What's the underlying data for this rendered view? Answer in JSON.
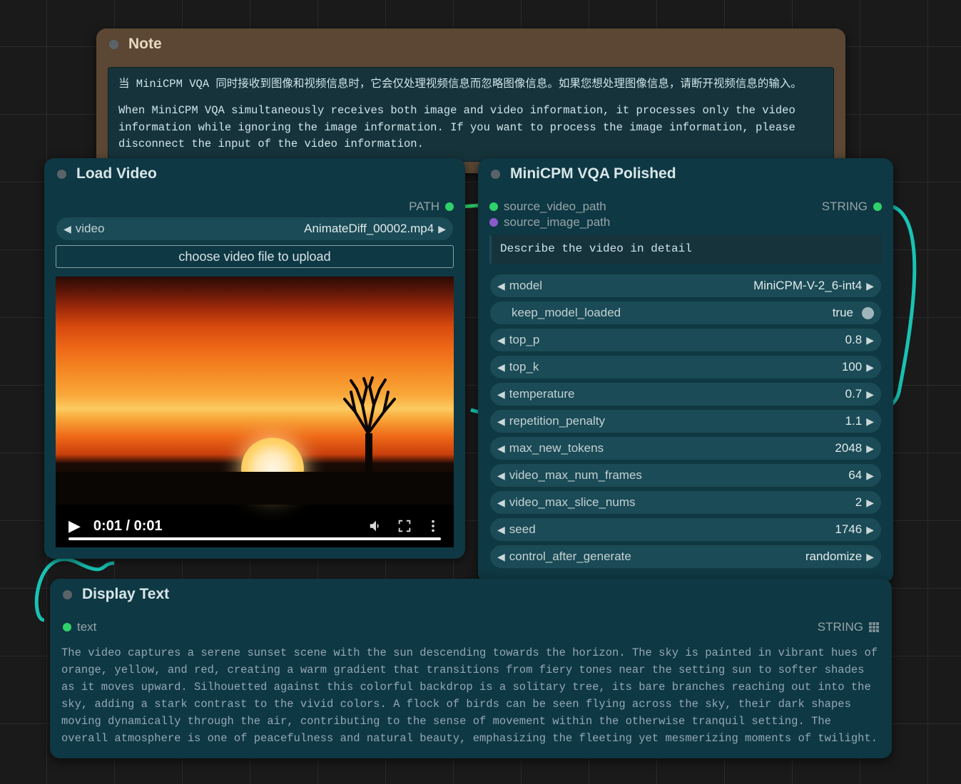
{
  "note": {
    "title": "Note",
    "text_cn": "当 MiniCPM VQA 同时接收到图像和视频信息时，它会仅处理视频信息而忽略图像信息。如果您想处理图像信息，请断开视频信息的输入。",
    "text_en": "When MiniCPM VQA simultaneously receives both image and video information, it processes only the video information while ignoring the image information. If you want to process the image information, please disconnect the input of the video information."
  },
  "load_video": {
    "title": "Load Video",
    "out_label": "PATH",
    "video_label": "video",
    "video_value": "AnimateDiff_00002.mp4",
    "choose_btn": "choose video file to upload",
    "player_time": "0:01 / 0:01"
  },
  "vqa": {
    "title": "MiniCPM VQA Polished",
    "out_label": "STRING",
    "in1": "source_video_path",
    "in2": "source_image_path",
    "prompt": "Describe the video in detail",
    "params": [
      {
        "label": "model",
        "value": "MiniCPM-V-2_6-int4",
        "arrows": true
      },
      {
        "label": "keep_model_loaded",
        "value": "true",
        "toggle": true
      },
      {
        "label": "top_p",
        "value": "0.8",
        "arrows": true
      },
      {
        "label": "top_k",
        "value": "100",
        "arrows": true
      },
      {
        "label": "temperature",
        "value": "0.7",
        "arrows": true
      },
      {
        "label": "repetition_penalty",
        "value": "1.1",
        "arrows": true
      },
      {
        "label": "max_new_tokens",
        "value": "2048",
        "arrows": true
      },
      {
        "label": "video_max_num_frames",
        "value": "64",
        "arrows": true
      },
      {
        "label": "video_max_slice_nums",
        "value": "2",
        "arrows": true
      },
      {
        "label": "seed",
        "value": "1746",
        "arrows": true
      },
      {
        "label": "control_after_generate",
        "value": "randomize",
        "arrows": true
      }
    ]
  },
  "display": {
    "title": "Display Text",
    "in_label": "text",
    "out_label": "STRING",
    "body": "The video captures a serene sunset scene with the sun descending towards the horizon. The sky is painted in vibrant hues of orange, yellow, and red, creating a warm gradient that transitions from fiery tones near the setting sun to softer shades as it moves upward. Silhouetted against this colorful backdrop is a solitary tree, its bare branches reaching out into the sky, adding a stark contrast to the vivid colors. A flock of birds can be seen flying across the sky, their dark shapes moving dynamically through the air, contributing to the sense of movement within the otherwise tranquil setting. The overall atmosphere is one of peacefulness and natural beauty, emphasizing the fleeting yet mesmerizing moments of twilight."
  }
}
